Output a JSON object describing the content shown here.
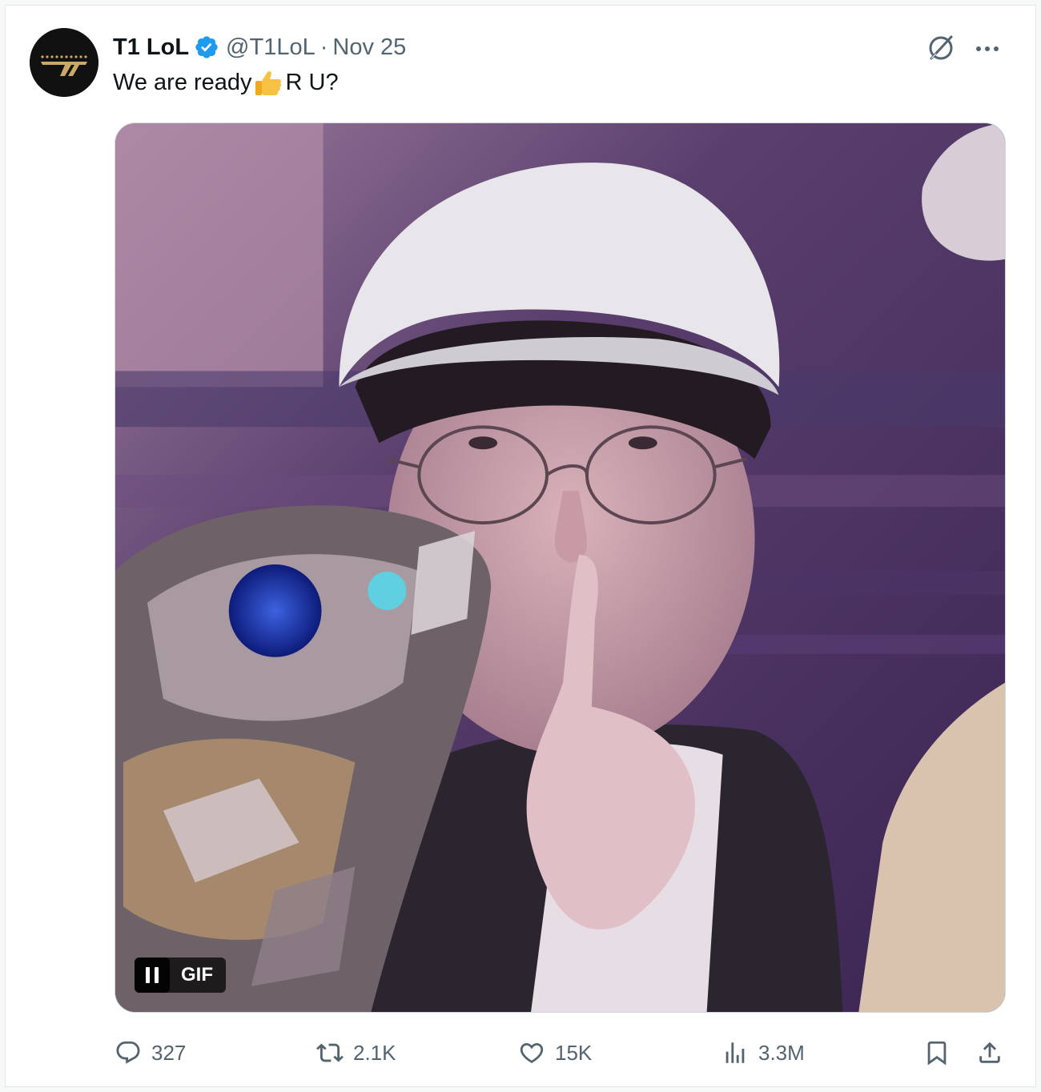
{
  "tweet": {
    "display_name": "T1 LoL",
    "handle": "@T1LoL",
    "separator": "·",
    "date": "Nov 25",
    "text_before": "We are ready",
    "text_after": " R U?",
    "emoji": "thumbs-up"
  },
  "media": {
    "badge_label": "GIF",
    "pause_icon": "pause-icon"
  },
  "actions": {
    "replies": "327",
    "reposts": "2.1K",
    "likes": "15K",
    "views": "3.3M"
  },
  "colors": {
    "verified": "#1d9bf0",
    "secondary_text": "#536471",
    "primary_text": "#0f1419",
    "avatar_bg": "#111111",
    "avatar_logo": "#c9a86a"
  }
}
